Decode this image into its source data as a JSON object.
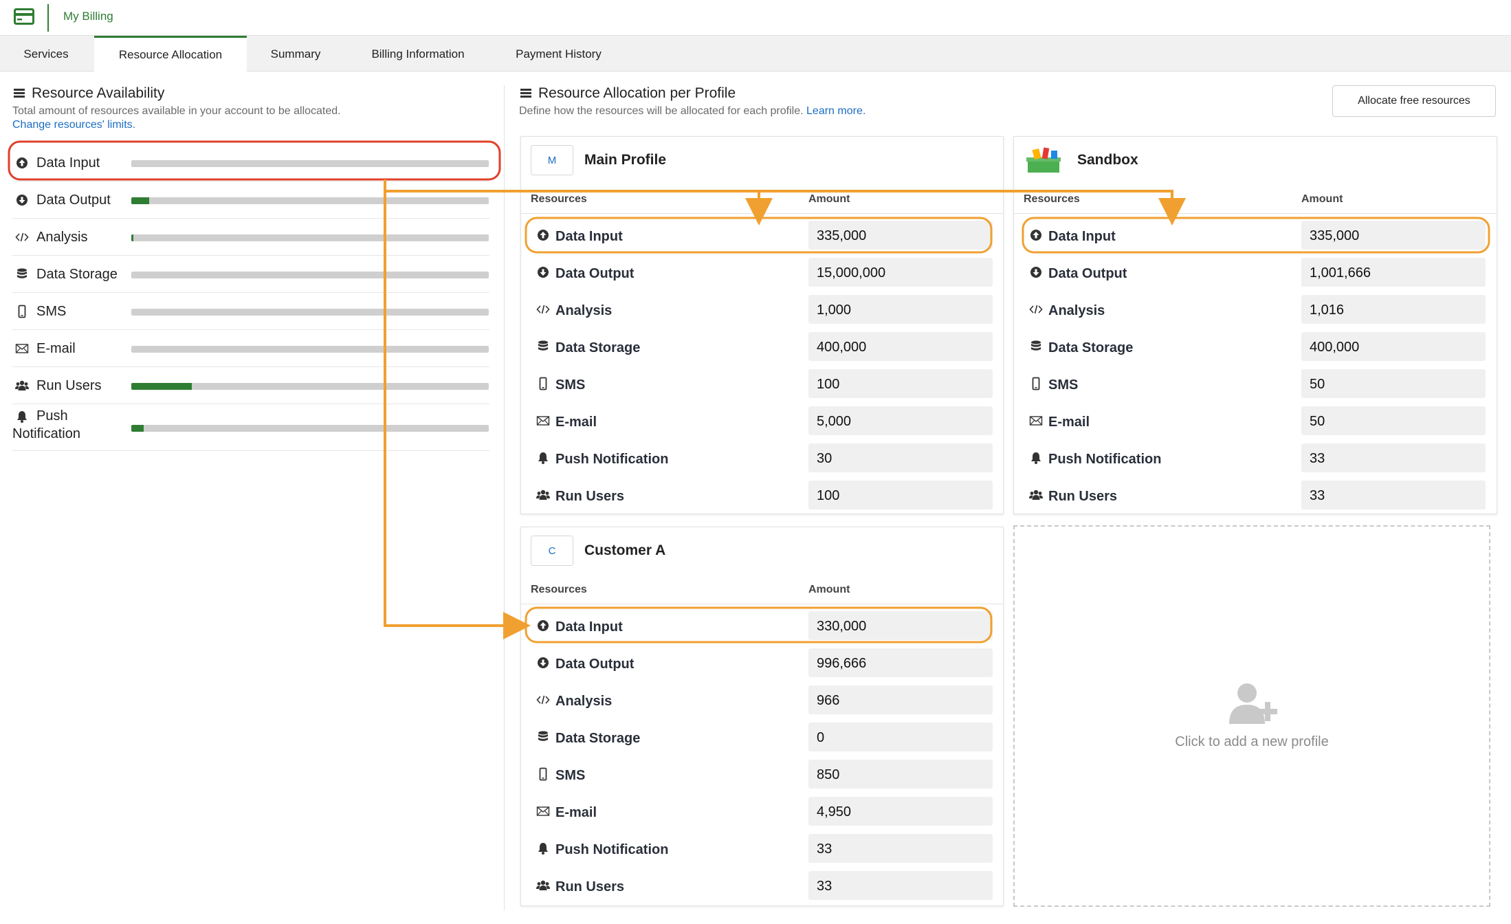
{
  "app": {
    "title": "My Billing",
    "icon": "credit-card-icon",
    "accent": "#2e7d32"
  },
  "tabs": [
    {
      "label": "Services",
      "active": false
    },
    {
      "label": "Resource Allocation",
      "active": true
    },
    {
      "label": "Summary",
      "active": false
    },
    {
      "label": "Billing Information",
      "active": false
    },
    {
      "label": "Payment History",
      "active": false
    }
  ],
  "availability": {
    "title": "Resource Availability",
    "description": "Total amount of resources available in your account to be allocated.",
    "link": "Change resources' limits.",
    "items": [
      {
        "label": "Data Input",
        "icon": "upload-circle-icon",
        "fill": 0.0
      },
      {
        "label": "Data Output",
        "icon": "download-circle-icon",
        "fill": 0.05
      },
      {
        "label": "Analysis",
        "icon": "code-icon",
        "fill": 0.005
      },
      {
        "label": "Data Storage",
        "icon": "database-icon",
        "fill": 0.0
      },
      {
        "label": "SMS",
        "icon": "mobile-icon",
        "fill": 0.0
      },
      {
        "label": "E-mail",
        "icon": "envelope-icon",
        "fill": 0.0
      },
      {
        "label": "Run Users",
        "icon": "users-icon",
        "fill": 0.17
      },
      {
        "label": "Push\nNotification",
        "icon": "bell-icon",
        "fill": 0.035
      }
    ]
  },
  "allocation": {
    "title": "Resource Allocation per Profile",
    "description": "Define how the resources will be allocated for each profile.",
    "link": "Learn more.",
    "allocate_button": "Allocate free resources",
    "col_resources": "Resources",
    "col_amount": "Amount",
    "profiles": [
      {
        "name": "Main Profile",
        "avatar": "M",
        "rows": [
          {
            "label": "Data Input",
            "icon": "upload-circle-icon",
            "amount": "335,000"
          },
          {
            "label": "Data Output",
            "icon": "download-circle-icon",
            "amount": "15,000,000"
          },
          {
            "label": "Analysis",
            "icon": "code-icon",
            "amount": "1,000"
          },
          {
            "label": "Data Storage",
            "icon": "database-icon",
            "amount": "400,000"
          },
          {
            "label": "SMS",
            "icon": "mobile-icon",
            "amount": "100"
          },
          {
            "label": "E-mail",
            "icon": "envelope-icon",
            "amount": "5,000"
          },
          {
            "label": "Push Notification",
            "icon": "bell-icon",
            "amount": "30"
          },
          {
            "label": "Run Users",
            "icon": "users-icon",
            "amount": "100"
          }
        ]
      },
      {
        "name": "Sandbox",
        "avatar": "",
        "rows": [
          {
            "label": "Data Input",
            "icon": "upload-circle-icon",
            "amount": "335,000"
          },
          {
            "label": "Data Output",
            "icon": "download-circle-icon",
            "amount": "1,001,666"
          },
          {
            "label": "Analysis",
            "icon": "code-icon",
            "amount": "1,016"
          },
          {
            "label": "Data Storage",
            "icon": "database-icon",
            "amount": "400,000"
          },
          {
            "label": "SMS",
            "icon": "mobile-icon",
            "amount": "50"
          },
          {
            "label": "E-mail",
            "icon": "envelope-icon",
            "amount": "50"
          },
          {
            "label": "Push Notification",
            "icon": "bell-icon",
            "amount": "33"
          },
          {
            "label": "Run Users",
            "icon": "users-icon",
            "amount": "33"
          }
        ]
      },
      {
        "name": "Customer A",
        "avatar": "C",
        "rows": [
          {
            "label": "Data Input",
            "icon": "upload-circle-icon",
            "amount": "330,000"
          },
          {
            "label": "Data Output",
            "icon": "download-circle-icon",
            "amount": "996,666"
          },
          {
            "label": "Analysis",
            "icon": "code-icon",
            "amount": "966"
          },
          {
            "label": "Data Storage",
            "icon": "database-icon",
            "amount": "0"
          },
          {
            "label": "SMS",
            "icon": "mobile-icon",
            "amount": "850"
          },
          {
            "label": "E-mail",
            "icon": "envelope-icon",
            "amount": "4,950"
          },
          {
            "label": "Push Notification",
            "icon": "bell-icon",
            "amount": "33"
          },
          {
            "label": "Run Users",
            "icon": "users-icon",
            "amount": "33"
          }
        ]
      }
    ],
    "add_profile": "Click to add a new profile"
  },
  "annotation_colors": {
    "highlight_red": "#e0402a",
    "highlight_orange": "#f0a030"
  }
}
